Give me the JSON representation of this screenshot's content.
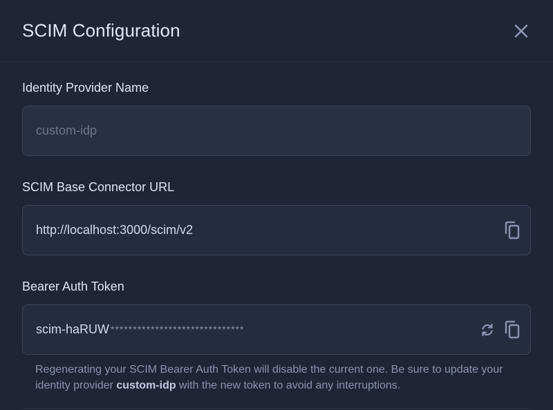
{
  "modal": {
    "title": "SCIM Configuration"
  },
  "fields": {
    "idp_name": {
      "label": "Identity Provider Name",
      "placeholder": "custom-idp"
    },
    "base_url": {
      "label": "SCIM Base Connector URL",
      "value": "http://localhost:3000/scim/v2"
    },
    "bearer_token": {
      "label": "Bearer Auth Token",
      "prefix": "scim-haRUW",
      "masked": "******************************"
    }
  },
  "help": {
    "part1": "Regenerating your SCIM Bearer Auth Token will disable the current one. Be sure to update your identity provider ",
    "idp": "custom-idp",
    "part2": " with the new token to avoid any interruptions."
  },
  "icons": {
    "close": "close-icon",
    "copy": "copy-icon",
    "refresh": "refresh-icon"
  },
  "colors": {
    "background": "#1f2437",
    "input_bg": "#262c40",
    "border": "#3d4459",
    "icon": "#8a93b0"
  }
}
